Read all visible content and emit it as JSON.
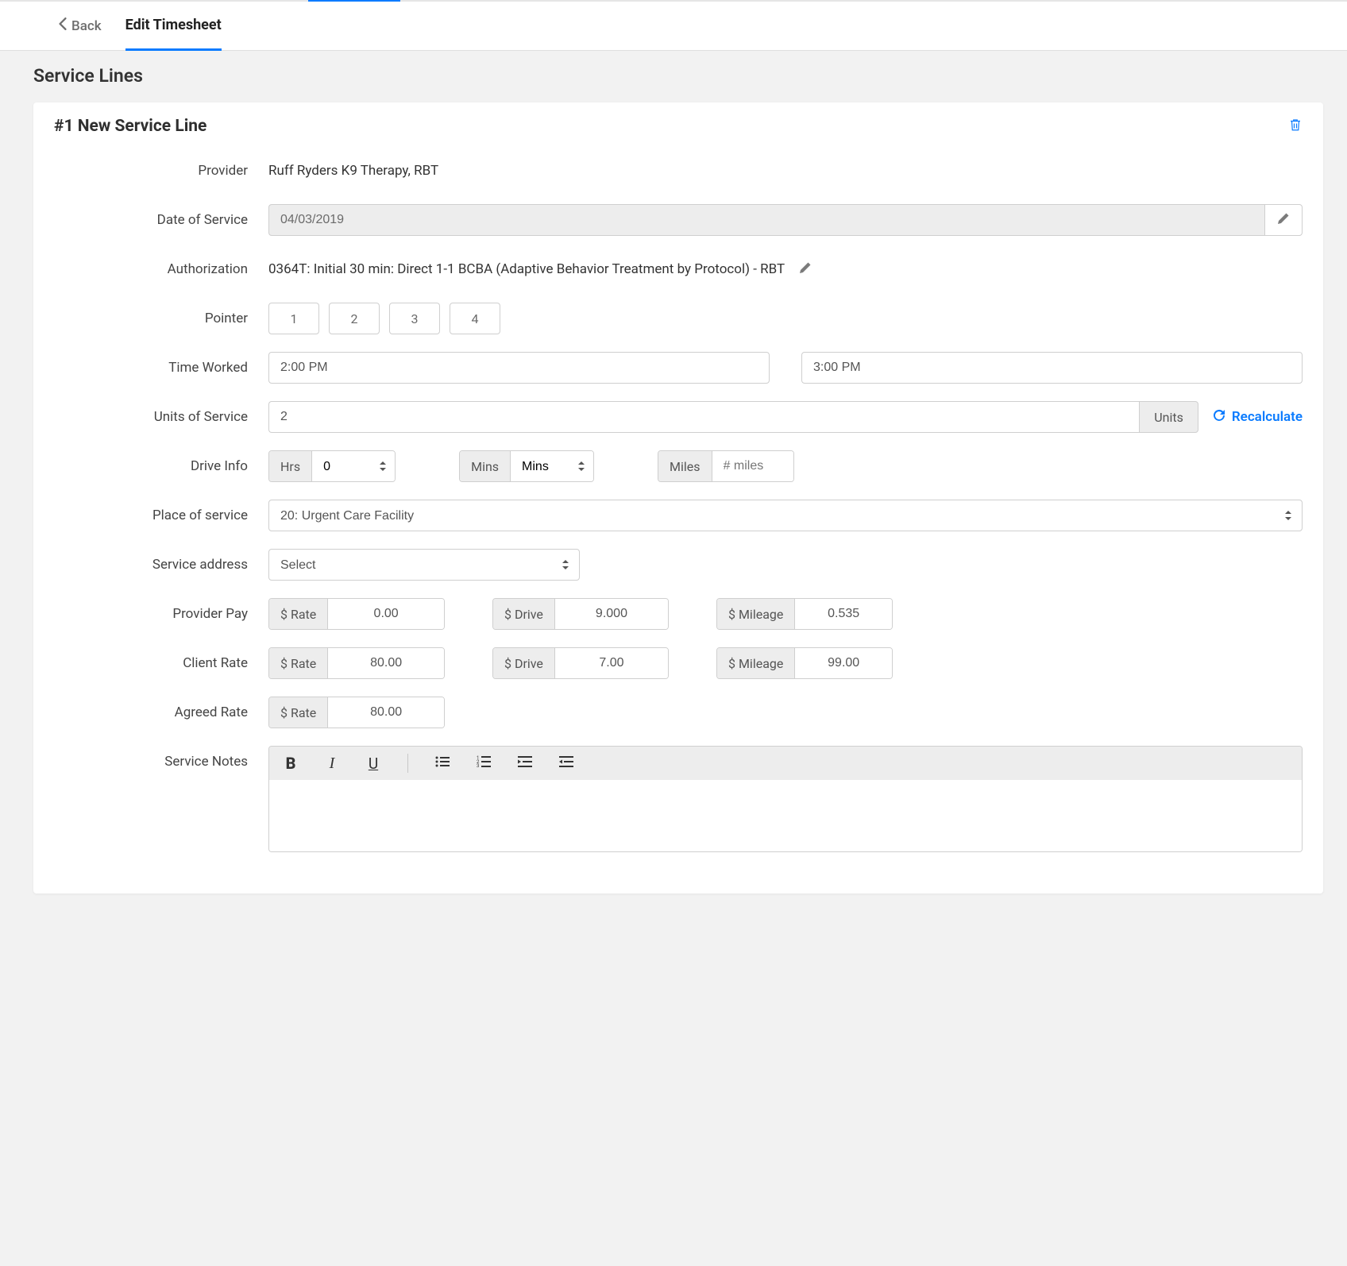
{
  "header": {
    "back_label": "Back",
    "tab_label": "Edit Timesheet"
  },
  "page_title": "Service Lines",
  "card": {
    "title": "#1 New Service Line",
    "labels": {
      "provider": "Provider",
      "date_of_service": "Date of Service",
      "authorization": "Authorization",
      "pointer": "Pointer",
      "time_worked": "Time Worked",
      "units_of_service": "Units of Service",
      "drive_info": "Drive Info",
      "place_of_service": "Place of service",
      "service_address": "Service address",
      "provider_pay": "Provider Pay",
      "client_rate": "Client Rate",
      "agreed_rate": "Agreed Rate",
      "service_notes": "Service Notes"
    },
    "provider_value": "Ruff Ryders K9 Therapy, RBT",
    "date_value": "04/03/2019",
    "authorization_value": "0364T: Initial 30 min: Direct 1-1 BCBA (Adaptive Behavior Treatment by Protocol) - RBT",
    "pointers": [
      "1",
      "2",
      "3",
      "4"
    ],
    "time_start": "2:00 PM",
    "time_end": "3:00 PM",
    "units_value": "2",
    "units_suffix": "Units",
    "recalculate_label": "Recalculate",
    "drive": {
      "hrs_label": "Hrs",
      "hrs_value": "0",
      "mins_label": "Mins",
      "mins_placeholder": "Mins",
      "miles_label": "Miles",
      "miles_placeholder": "# miles"
    },
    "place_of_service_value": "20: Urgent Care Facility",
    "service_address_value": "Select",
    "pay_labels": {
      "rate": "$ Rate",
      "drive": "$ Drive",
      "mileage": "$ Mileage"
    },
    "provider_pay": {
      "rate": "0.00",
      "drive": "9.000",
      "mileage": "0.535"
    },
    "client_rate": {
      "rate": "80.00",
      "drive": "7.00",
      "mileage": "99.00"
    },
    "agreed_rate": {
      "rate": "80.00"
    }
  }
}
